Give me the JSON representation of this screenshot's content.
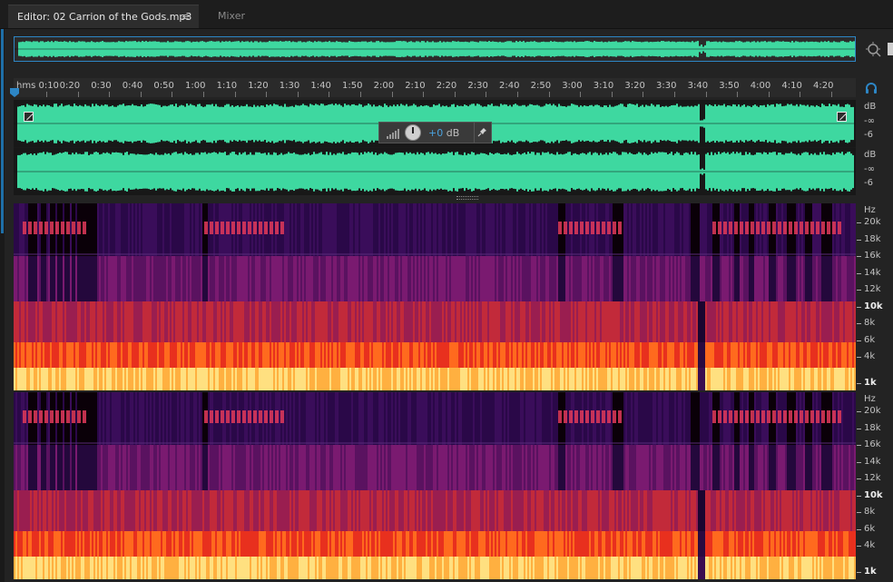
{
  "tabs": {
    "editor_label": "Editor: 02 Carrion of the Gods.mp3",
    "menu_icon": "≡",
    "mixer_label": "Mixer"
  },
  "timeline": {
    "ticks": [
      "hms 0:10",
      "0:20",
      "0:30",
      "0:40",
      "0:50",
      "1:00",
      "1:10",
      "1:20",
      "1:30",
      "1:40",
      "1:50",
      "2:00",
      "2:10",
      "2:20",
      "2:30",
      "2:40",
      "2:50",
      "3:00",
      "3:10",
      "3:20",
      "3:30",
      "3:40",
      "3:50",
      "4:00",
      "4:10",
      "4:20"
    ]
  },
  "amplitude_scale": [
    "dB",
    "-∞",
    "-6"
  ],
  "frequency_scale": {
    "unit": "Hz",
    "labels": [
      "20k",
      "18k",
      "16k",
      "14k",
      "12k",
      "10k",
      "8k",
      "6k",
      "4k",
      "1k"
    ]
  },
  "hud": {
    "value": "+0",
    "unit": "dB"
  },
  "icons": {
    "zoom": "zoom-icon",
    "headphones": "headphones-icon",
    "playhead": "playhead-icon",
    "pin": "pin-icon",
    "volume_meter": "volume-meter-icon",
    "volume_knob": "volume-knob-icon",
    "fade_handle": "fade-handle-icon"
  },
  "colors": {
    "waveform": "#3ed8a0",
    "accent": "#2d86c5",
    "spectral_low": "#ffe080",
    "spectral_mid": "#e8301e",
    "spectral_high": "#3a0d5a"
  }
}
